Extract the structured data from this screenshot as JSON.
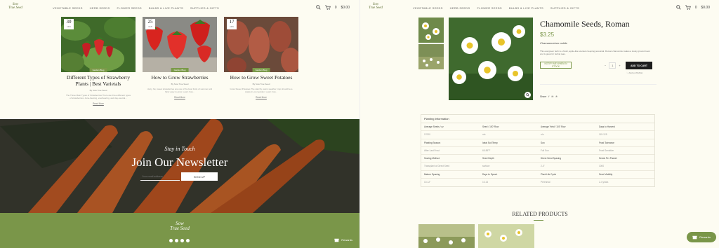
{
  "nav": {
    "logo_lines": [
      "Sow",
      "True Seed"
    ],
    "menu": [
      "VEGETABLE SEEDS",
      "HERB SEEDS",
      "FLOWER SEEDS",
      "BULBS & LIVE PLANTS",
      "SUPPLIES & GIFTS"
    ],
    "cart_count": "0",
    "cart_total": "$0.00"
  },
  "blog": {
    "cards": [
      {
        "day": "30",
        "month": "JAN",
        "category": "Garden Blog",
        "title": "Different Types of Strawberry Plants | Best Varietals",
        "author": "By Sow True Seed",
        "excerpt": "The Three Main Types of Strawberries There are three different types of strawberries: June-bearing, everbearing, and day-neutral...",
        "more": "Read More"
      },
      {
        "day": "25",
        "month": "JAN",
        "category": "Garden Blog",
        "title": "How to Grow Strawberries",
        "author": "By Sow True Seed",
        "excerpt": "Juicy, fat, sweet strawberries are one of the best fruits of summer and fairly easy to grow. Learn how...",
        "more": "Read More"
      },
      {
        "day": "17",
        "month": "JAN",
        "category": "Garden Blog",
        "title": "How to Grow Sweet Potatoes",
        "author": "By Sow True Seed",
        "excerpt": "Grow Sweet Potatoes The starchy, warm-weather crop should be a staple in your garden. Learn how...",
        "more": "Read More"
      }
    ]
  },
  "newsletter": {
    "kicker": "Stay in Touch",
    "heading": "Join Our Newsletter",
    "email_placeholder": "Your email address",
    "signup": "SIGN UP"
  },
  "footer": {
    "logo_lines": [
      "Sow",
      "True Seed"
    ],
    "rewards": "Rewards"
  },
  "product": {
    "title": "Chamomile Seeds, Roman",
    "price": "$3.25",
    "latin": "Chamaemelum nobile",
    "description": "This evergreen herb is a fresh, apple-like scented creeping perennial. Roman chamomile makes a lovely ground cover and is great for herbal teas.",
    "notify": "NOTIFY ME WHEN IN STOCK",
    "qty": "1",
    "add_to_cart": "ADD TO CART",
    "wishlist": "Add to Wishlist",
    "share": "Share",
    "planting_title": "Planting Information",
    "table": [
      [
        "Average Seeds / oz",
        "Seed / 100' Row",
        "Average Yield / 100' Row",
        "Days to Harvest"
      ],
      [
        "17000",
        "n/a",
        "n/a",
        "115-125"
      ],
      [
        "Planting Season",
        "Ideal Soil Temp",
        "Sun",
        "Frost Tolerance"
      ],
      [
        "After Last Frost",
        "65-85°F",
        "Full Sun",
        "Frost Sensitive"
      ],
      [
        "Sowing Method",
        "Seed Depth",
        "Direct Seed Spacing",
        "Seeds Per Packet"
      ],
      [
        "Transplant or Direct Seed",
        "surface",
        "2-4\"",
        "1000"
      ],
      [
        "Mature Spacing",
        "Days to Sprout",
        "Plant Life Cycle",
        "Seed Viability"
      ],
      [
        "10-12\"",
        "10-14",
        "Perennial",
        "2-4 years"
      ]
    ],
    "related_heading": "RELATED PRODUCTS"
  }
}
